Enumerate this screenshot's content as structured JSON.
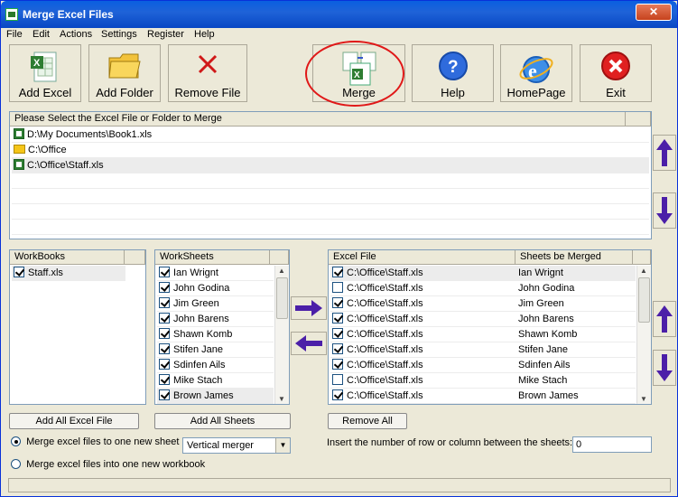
{
  "window": {
    "title": "Merge Excel Files",
    "close_glyph": "✕"
  },
  "menu": [
    "File",
    "Edit",
    "Actions",
    "Settings",
    "Register",
    "Help"
  ],
  "toolbar": {
    "add_excel": "Add Excel",
    "add_folder": "Add Folder",
    "remove_file": "Remove File",
    "merge": "Merge",
    "help": "Help",
    "homepage": "HomePage",
    "exit": "Exit"
  },
  "file_list": {
    "header": "Please Select the Excel File or Folder to Merge",
    "items": [
      {
        "path": "D:\\My Documents\\Book1.xls",
        "icon": "excel-file-icon"
      },
      {
        "path": "C:\\Office",
        "icon": "folder-icon"
      },
      {
        "path": "C:\\Office\\Staff.xls",
        "icon": "excel-file-icon"
      }
    ]
  },
  "workbooks": {
    "header": "WorkBooks",
    "items": [
      {
        "name": "Staff.xls",
        "checked": true
      }
    ]
  },
  "worksheets": {
    "header": "WorkSheets",
    "items": [
      {
        "name": "Ian Wrignt",
        "checked": true
      },
      {
        "name": "John Godina",
        "checked": true
      },
      {
        "name": "Jim Green",
        "checked": true
      },
      {
        "name": "John Barens",
        "checked": true
      },
      {
        "name": "Shawn Komb",
        "checked": true
      },
      {
        "name": "Stifen Jane",
        "checked": true
      },
      {
        "name": "Sdinfen Ails",
        "checked": true
      },
      {
        "name": "Mike Stach",
        "checked": true
      },
      {
        "name": "Brown James",
        "checked": true
      }
    ]
  },
  "merged": {
    "col_file": "Excel File",
    "col_sheet": "Sheets be Merged",
    "rows": [
      {
        "file": "C:\\Office\\Staff.xls",
        "sheet": "Ian Wrignt",
        "checked": true
      },
      {
        "file": "C:\\Office\\Staff.xls",
        "sheet": "John Godina",
        "checked": false
      },
      {
        "file": "C:\\Office\\Staff.xls",
        "sheet": "Jim Green",
        "checked": true
      },
      {
        "file": "C:\\Office\\Staff.xls",
        "sheet": "John Barens",
        "checked": true
      },
      {
        "file": "C:\\Office\\Staff.xls",
        "sheet": "Shawn Komb",
        "checked": true
      },
      {
        "file": "C:\\Office\\Staff.xls",
        "sheet": "Stifen Jane",
        "checked": true
      },
      {
        "file": "C:\\Office\\Staff.xls",
        "sheet": "Sdinfen Ails",
        "checked": true
      },
      {
        "file": "C:\\Office\\Staff.xls",
        "sheet": "Mike Stach",
        "checked": false
      },
      {
        "file": "C:\\Office\\Staff.xls",
        "sheet": "Brown James",
        "checked": true
      }
    ]
  },
  "buttons": {
    "add_all_excel": "Add All Excel File",
    "add_all_sheets": "Add All Sheets",
    "remove_all": "Remove All"
  },
  "options": {
    "radio1": "Merge excel files to one new sheet",
    "radio2": "Merge excel files into one new workbook",
    "merge_mode": "Vertical merger",
    "insert_label": "Insert the number of row or column between the sheets:",
    "insert_value": "0"
  },
  "colors": {
    "title_bar": "#0a5fe0",
    "close": "#c6421d",
    "highlight_ring": "#e01818",
    "arrow": "#4b1fa8"
  }
}
